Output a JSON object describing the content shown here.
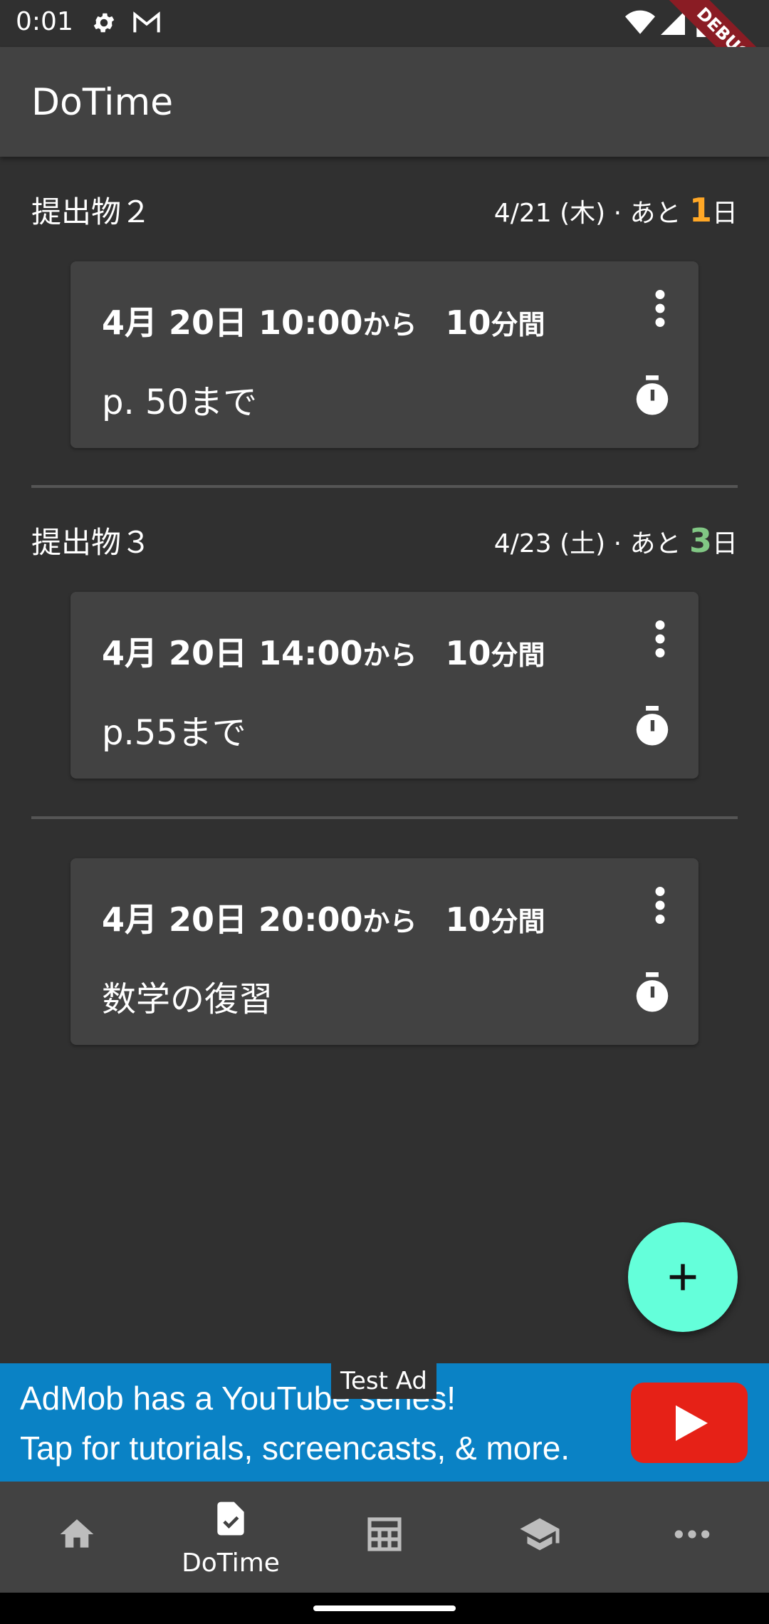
{
  "status_bar": {
    "time": "0:01",
    "debug_label": "DEBUG"
  },
  "app_bar": {
    "title": "DoTime"
  },
  "groups": [
    {
      "name": "提出物２",
      "due_date": "4/21 (木) · あと",
      "days_left": "1",
      "days_unit": "日",
      "days_color": "#ffa726",
      "tasks": [
        {
          "time_prefix": "4月 20日  10:00",
          "time_from": "から",
          "duration": "10",
          "duration_unit": "分間",
          "memo": "p. 50まで"
        }
      ]
    },
    {
      "name": "提出物３",
      "due_date": "4/23 (土) · あと",
      "days_left": "3",
      "days_unit": "日",
      "days_color": "#81c784",
      "tasks": [
        {
          "time_prefix": "4月 20日  14:00",
          "time_from": "から",
          "duration": "10",
          "duration_unit": "分間",
          "memo": "p.55まで"
        }
      ]
    },
    {
      "name": "",
      "tasks": [
        {
          "time_prefix": "4月 20日  20:00",
          "time_from": "から",
          "duration": "10",
          "duration_unit": "分間",
          "memo": "数学の復習"
        }
      ]
    }
  ],
  "fab": {
    "icon": "plus-icon"
  },
  "ad": {
    "label": "Test Ad",
    "line1": "AdMob has a YouTube series!",
    "line2": "Tap for tutorials, screencasts, & more."
  },
  "bottom_nav": {
    "items": [
      {
        "icon": "home-icon",
        "label": ""
      },
      {
        "icon": "task-check-icon",
        "label": "DoTime"
      },
      {
        "icon": "timetable-icon",
        "label": ""
      },
      {
        "icon": "school-icon",
        "label": ""
      },
      {
        "icon": "more-horiz-icon",
        "label": ""
      }
    ]
  },
  "colors": {
    "background": "#303030",
    "surface": "#424242",
    "accent": "#64ffda",
    "ad_blue": "#0a82c5"
  }
}
